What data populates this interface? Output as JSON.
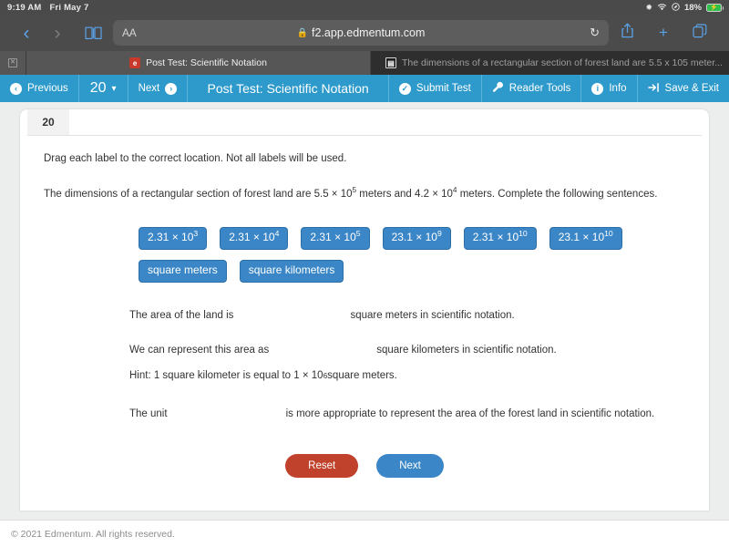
{
  "status_bar": {
    "time": "9:19 AM",
    "date": "Fri May 7",
    "bluetooth_icon": "bluetooth-icon",
    "wifi_icon": "wifi-icon",
    "location_icon": "location-icon",
    "battery_percent": "18%",
    "battery_icon": "battery-charging-icon"
  },
  "browser": {
    "back_icon": "back-chevron-icon",
    "forward_icon": "forward-chevron-icon",
    "bookmarks_icon": "book-icon",
    "text_size_label": "AA",
    "lock_icon": "lock-icon",
    "url": "f2.app.edmentum.com",
    "reload_icon": "reload-icon",
    "share_icon": "share-icon",
    "new_tab_icon": "plus-icon",
    "tabs_icon": "tabs-overview-icon",
    "tabs": [
      {
        "title": "Post Test: Scientific Notation",
        "favicon": "edmentum-favicon",
        "active": true
      },
      {
        "title": "The dimensions of a rectangular section of forest land are 5.5 x 105 meter...",
        "favicon": "document-favicon",
        "active": false
      }
    ],
    "close_tab_icon": "close-tab-icon"
  },
  "appbar": {
    "previous_label": "Previous",
    "previous_icon": "arrow-left-circle-icon",
    "page_number": "20",
    "page_caret_icon": "chevron-down-icon",
    "next_label": "Next",
    "next_icon": "arrow-right-circle-icon",
    "title": "Post Test: Scientific Notation",
    "submit_label": "Submit Test",
    "submit_icon": "check-circle-icon",
    "reader_tools_label": "Reader Tools",
    "reader_tools_icon": "wrench-icon",
    "info_label": "Info",
    "info_icon": "info-circle-icon",
    "save_exit_label": "Save & Exit",
    "save_exit_icon": "exit-arrow-icon",
    "accent_color": "#2e9acb"
  },
  "question": {
    "number": "20",
    "instruction": "Drag each label to the correct location. Not all labels will be used.",
    "stem_parts": {
      "p1": "The dimensions of a rectangular section of forest land are 5.5 × 10",
      "e1": "5",
      "p2": " meters and 4.2 × 10",
      "e2": "4",
      "p3": " meters. Complete the following sentences."
    },
    "chips_row1": [
      {
        "base": "2.31 × 10",
        "exp": "3"
      },
      {
        "base": "2.31 × 10",
        "exp": "4"
      },
      {
        "base": "2.31 × 10",
        "exp": "5"
      },
      {
        "base": "23.1 × 10",
        "exp": "9"
      },
      {
        "base": "2.31 × 10",
        "exp": "10"
      },
      {
        "base": "23.1 × 10",
        "exp": "10"
      }
    ],
    "chips_row2": [
      {
        "base": "square meters",
        "exp": ""
      },
      {
        "base": "square kilometers",
        "exp": ""
      }
    ],
    "sentence1_before": "The area of the land is",
    "sentence1_after": "square meters in scientific notation.",
    "sentence2_before": "We can represent this area as",
    "sentence2_after": "square kilometers in scientific notation.",
    "hint_before": "Hint: 1 square kilometer is equal to 1 × 10",
    "hint_exp": "6",
    "hint_after": " square meters.",
    "sentence3_before": "The unit",
    "sentence3_after": "is more appropriate to represent the area of the forest land in scientific notation.",
    "reset_label": "Reset",
    "next_label": "Next",
    "reset_color": "#c0412c",
    "next_color": "#3b86c6",
    "chip_color": "#3b86c6"
  },
  "footer": {
    "copyright": "© 2021 Edmentum. All rights reserved."
  }
}
